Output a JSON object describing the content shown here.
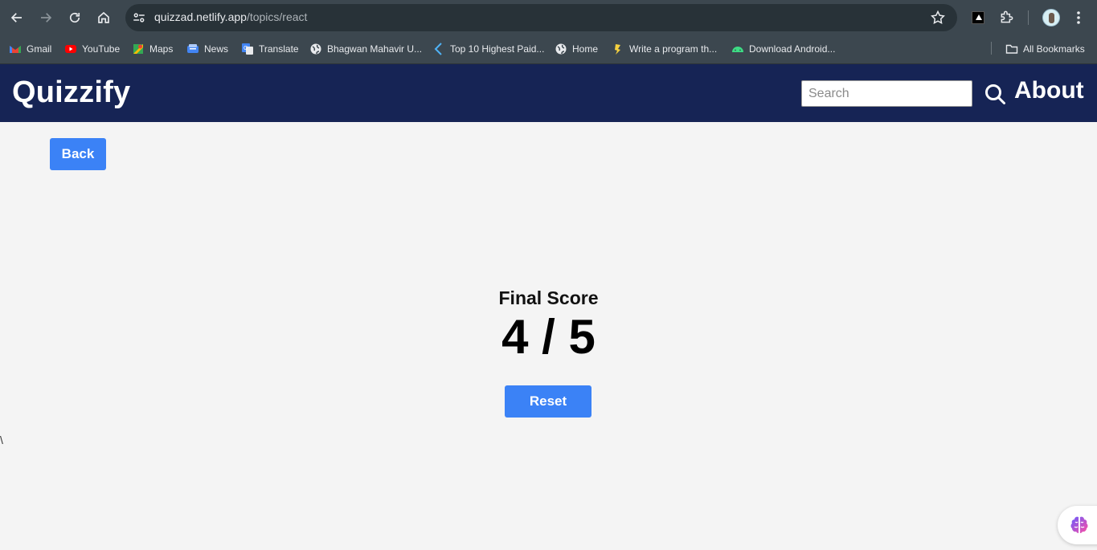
{
  "browser": {
    "url_host": "quizzad.netlify.app",
    "url_path": "/topics/react"
  },
  "bookmarks": {
    "items": [
      {
        "label": "Gmail",
        "icon": "gmail-icon",
        "color": "#ea4335"
      },
      {
        "label": "YouTube",
        "icon": "youtube-icon",
        "color": "#ff0000"
      },
      {
        "label": "Maps",
        "icon": "maps-icon",
        "color": "#34a853"
      },
      {
        "label": "News",
        "icon": "news-icon",
        "color": "#4285f4"
      },
      {
        "label": "Translate",
        "icon": "translate-icon",
        "color": "#4285f4"
      },
      {
        "label": "Bhagwan Mahavir U...",
        "icon": "globe-icon",
        "color": "#e8eaed"
      },
      {
        "label": "Top 10 Highest Paid...",
        "icon": "site-icon",
        "color": "#4fb3f6"
      },
      {
        "label": "Home",
        "icon": "globe-icon",
        "color": "#e8eaed"
      },
      {
        "label": "Write a program th...",
        "icon": "site-icon",
        "color": "#f4d03f"
      },
      {
        "label": "Download Android...",
        "icon": "android-icon",
        "color": "#3ddc84"
      }
    ],
    "all_bookmarks": "All Bookmarks"
  },
  "header": {
    "brand": "Quizzify",
    "search_placeholder": "Search",
    "about": "About"
  },
  "main": {
    "back_label": "Back",
    "score_label": "Final Score",
    "score_value": "4 / 5",
    "reset_label": "Reset",
    "stray_text": "\\"
  },
  "colors": {
    "header_bg": "#162455",
    "button_bg": "#3b82f6",
    "page_bg": "#f4f4f4"
  }
}
